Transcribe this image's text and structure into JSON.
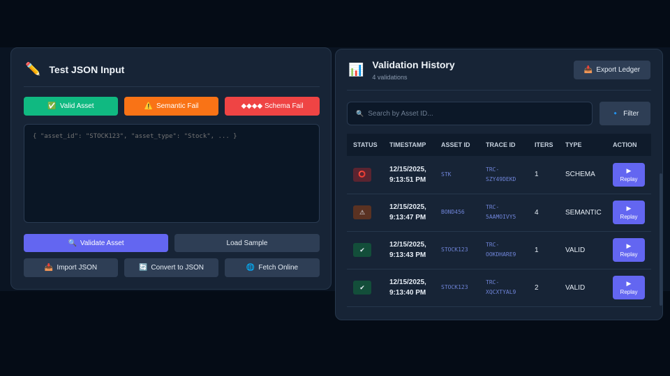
{
  "left": {
    "icon": "pencil-icon",
    "title": "Test JSON Input",
    "presets": [
      {
        "label": "Valid Asset",
        "icon": "✅",
        "color": "#10b981"
      },
      {
        "label": "Semantic Fail",
        "icon": "⚠️",
        "color": "#f97316"
      },
      {
        "label": "◆◆◆◆ Schema Fail",
        "icon": "",
        "color": "#ef4444"
      }
    ],
    "json_placeholder": "{ \"asset_id\": \"STOCK123\", \"asset_type\": \"Stock\", ... }",
    "validate_label": "Validate Asset",
    "load_sample_label": "Load Sample",
    "import_label": "Import JSON",
    "convert_label": "Convert to JSON",
    "fetch_label": "Fetch Online"
  },
  "right": {
    "icon": "chart-icon",
    "title": "Validation History",
    "subtitle": "4 validations",
    "export_label": "Export Ledger",
    "search_placeholder": "Search by Asset ID...",
    "filter_label": "Filter",
    "columns": [
      "STATUS",
      "TIMESTAMP",
      "ASSET ID",
      "TRACE ID",
      "ITERS",
      "TYPE",
      "ACTION"
    ],
    "rows": [
      {
        "status": "schema",
        "status_glyph": "⭕",
        "ts_date": "12/15/2025,",
        "ts_time": "9:13:51 PM",
        "asset": "STK",
        "trace1": "TRC-",
        "trace2": "SZY49DEKD",
        "iters": "1",
        "type": "SCHEMA",
        "action": "Replay"
      },
      {
        "status": "semantic",
        "status_glyph": "⚠",
        "ts_date": "12/15/2025,",
        "ts_time": "9:13:47 PM",
        "asset": "BOND456",
        "trace1": "TRC-",
        "trace2": "5AAMOIVY5",
        "iters": "4",
        "type": "SEMANTIC",
        "action": "Replay"
      },
      {
        "status": "valid",
        "status_glyph": "✔",
        "ts_date": "12/15/2025,",
        "ts_time": "9:13:43 PM",
        "asset": "STOCK123",
        "trace1": "TRC-",
        "trace2": "OOKDHARE9",
        "iters": "1",
        "type": "VALID",
        "action": "Replay"
      },
      {
        "status": "valid",
        "status_glyph": "✔",
        "ts_date": "12/15/2025,",
        "ts_time": "9:13:40 PM",
        "asset": "STOCK123",
        "trace1": "TRC-",
        "trace2": "XQCXTYAL9",
        "iters": "2",
        "type": "VALID",
        "action": "Replay"
      }
    ],
    "status_colors": {
      "schema": "#5b2430",
      "semantic": "#5a3222",
      "valid": "#134e3a"
    }
  }
}
